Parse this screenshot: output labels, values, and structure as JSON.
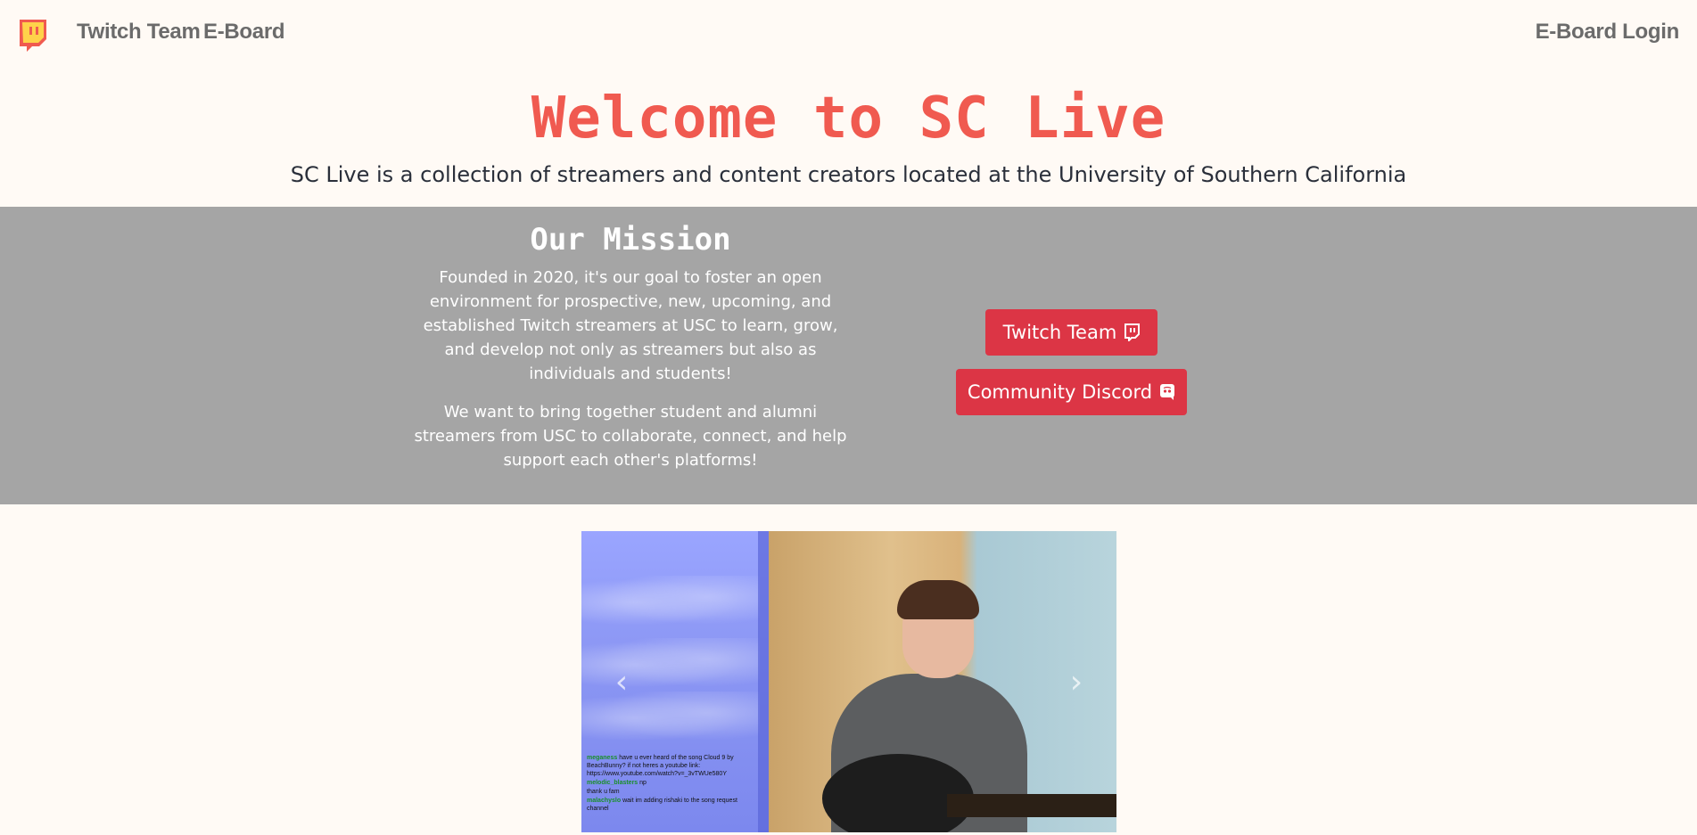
{
  "nav": {
    "logo_icon": "twitch-logo-icon",
    "links": [
      "Twitch Team",
      "E-Board"
    ],
    "login": "E-Board Login"
  },
  "hero": {
    "title": "Welcome to SC Live",
    "subtitle": "SC Live is a collection of streamers and content creators located at the University of Southern California"
  },
  "mission": {
    "title": "Our Mission",
    "paragraph1": "Founded in 2020, it's our goal to foster an open environment for prospective, new, upcoming, and established Twitch streamers at USC to learn, grow, and develop not only as streamers but also as individuals and students!",
    "paragraph2": "We want to bring together student and alumni streamers from USC to collaborate, connect, and help support each other's platforms!",
    "buttons": [
      {
        "label": "Twitch Team",
        "icon": "twitch-icon"
      },
      {
        "label": "Community Discord",
        "icon": "discord-icon"
      }
    ]
  },
  "carousel": {
    "prev_icon": "chevron-left-icon",
    "next_icon": "chevron-right-icon",
    "prev_glyph": "‹",
    "next_glyph": "›",
    "chat": [
      {
        "user": "meganess",
        "text": "have u ever heard of the song Cloud 9 by BeachBunny? if not heres a youtube link: https://www.youtube.com/watch?v=_3vTWUe580Y"
      },
      {
        "user": "melodic_blasters",
        "text": "np"
      },
      {
        "user": "",
        "text": "thank u fam"
      },
      {
        "user": "malachyslo",
        "text": "wait im adding rishaki to the song request channel"
      }
    ]
  },
  "colors": {
    "accent": "#f05a50",
    "button": "#dc3545",
    "mission_bg": "#a5a5a5",
    "page_bg": "#fffaf5",
    "nav_text": "#6b6b6b"
  }
}
